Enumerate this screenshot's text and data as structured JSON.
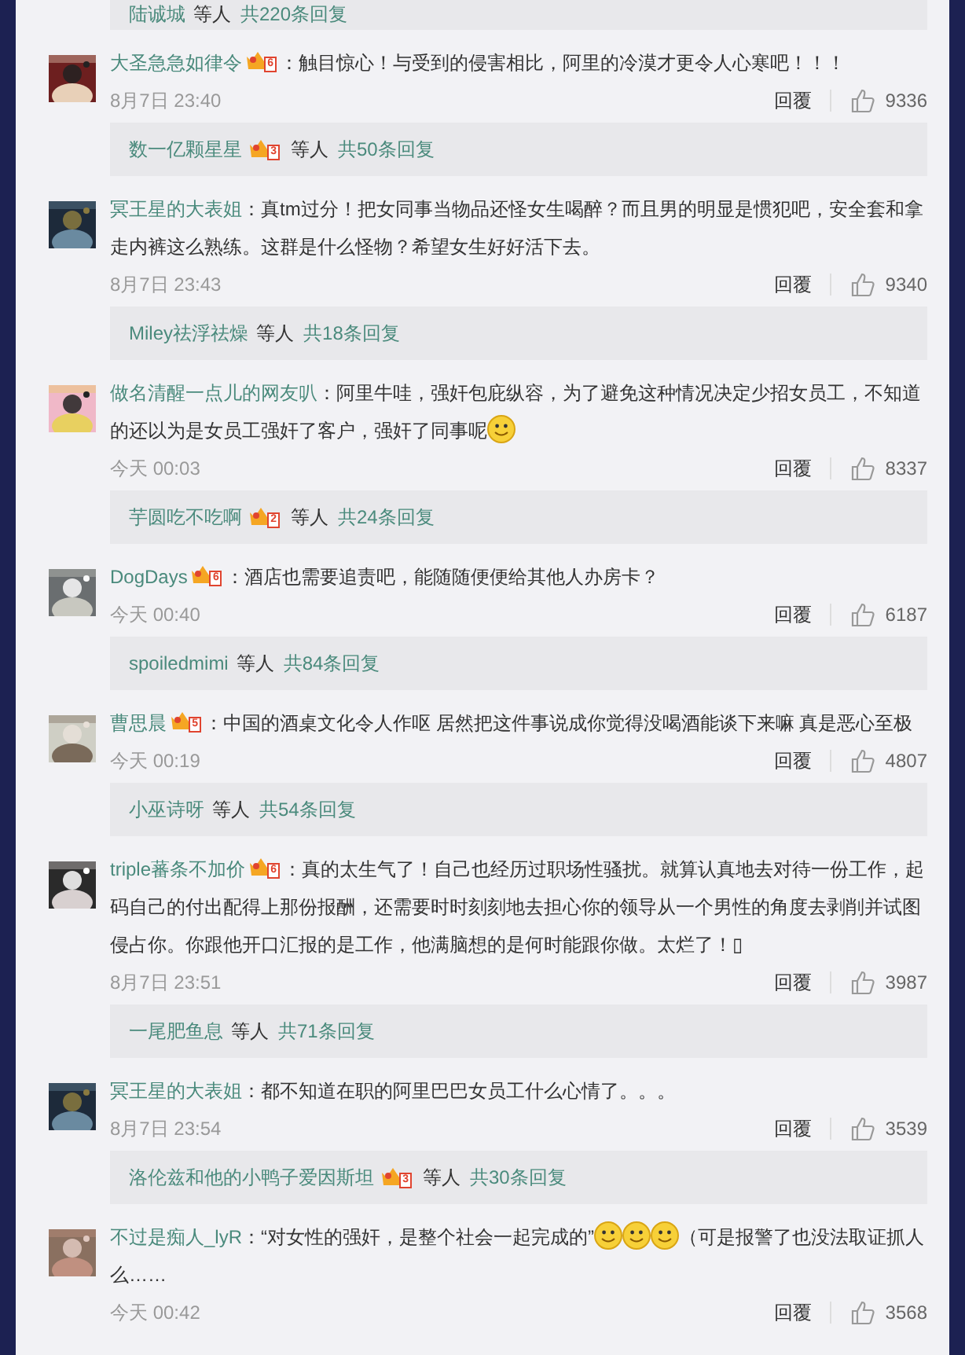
{
  "items": [
    {
      "kind": "reply_bar",
      "name": "陆诚城",
      "others": "等人",
      "count": "共220条回复"
    },
    {
      "kind": "comment",
      "name": "大圣急急如律令",
      "badge": "6",
      "parts": [
        {
          "kind": "text",
          "text": "：触目惊心！与受到的侵害相比，阿里的冷漠才更令人心寒吧！！！"
        }
      ],
      "time": "8月7日 23:40",
      "reply": "回覆",
      "likes": "9336"
    },
    {
      "kind": "reply_bar",
      "name": "数一亿颗星星",
      "badge": "3",
      "others": "等人",
      "count": "共50条回复"
    },
    {
      "kind": "comment",
      "name": "冥王星的大表姐",
      "parts": [
        {
          "kind": "text",
          "text": "：真tm过分！把女同事当物品还怪女生喝醉？而且男的明显是惯犯吧，安全套和拿走内裤这么熟练。这群是什么怪物？希望女生好好活下去。"
        }
      ],
      "time": "8月7日 23:43",
      "reply": "回覆",
      "likes": "9340"
    },
    {
      "kind": "reply_bar",
      "name": "Miley祛浮祛燥",
      "others": "等人",
      "count": "共18条回复"
    },
    {
      "kind": "comment",
      "name": "做名清醒一点儿的网友叭",
      "parts": [
        {
          "kind": "text",
          "text": "：阿里牛哇，强奸包庇纵容，为了避免这种情况决定少招女员工，不知道的还以为是女员工强奸了客户，强奸了同事呢"
        },
        {
          "kind": "smiley"
        }
      ],
      "time": "今天 00:03",
      "reply": "回覆",
      "likes": "8337"
    },
    {
      "kind": "reply_bar",
      "name": "芋圆吃不吃啊",
      "badge": "2",
      "others": "等人",
      "count": "共24条回复"
    },
    {
      "kind": "comment",
      "name": "DogDays",
      "badge": "6",
      "parts": [
        {
          "kind": "text",
          "text": "：酒店也需要追责吧，能随随便便给其他人办房卡？"
        }
      ],
      "time": "今天 00:40",
      "reply": "回覆",
      "likes": "6187"
    },
    {
      "kind": "reply_bar",
      "name": "spoiledmimi",
      "others": "等人",
      "count": "共84条回复"
    },
    {
      "kind": "comment",
      "name": "曹思晨",
      "badge": "5",
      "parts": [
        {
          "kind": "text",
          "text": "：中国的酒桌文化令人作呕 居然把这件事说成你觉得没喝酒能谈下来嘛 真是恶心至极"
        }
      ],
      "time": "今天 00:19",
      "reply": "回覆",
      "likes": "4807"
    },
    {
      "kind": "reply_bar",
      "name": "小巫诗呀",
      "others": "等人",
      "count": "共54条回复"
    },
    {
      "kind": "comment",
      "name": "triple蕃条不加价",
      "badge": "6",
      "parts": [
        {
          "kind": "text",
          "text": "：真的太生气了！自己也经历过职场性骚扰。就算认真地去对待一份工作，起码自己的付出配得上那份报酬，还需要时时刻刻地去担心你的领导从一个男性的角度去剥削并试图侵占你。你跟他开口汇报的是工作，他满脑想的是何时能跟你做。太烂了！▯"
        }
      ],
      "time": "8月7日 23:51",
      "reply": "回覆",
      "likes": "3987"
    },
    {
      "kind": "reply_bar",
      "name": "一尾肥鱼息",
      "others": "等人",
      "count": "共71条回复"
    },
    {
      "kind": "comment",
      "name": "冥王星的大表姐",
      "parts": [
        {
          "kind": "text",
          "text": "：都不知道在职的阿里巴巴女员工什么心情了。。。"
        }
      ],
      "time": "8月7日 23:54",
      "reply": "回覆",
      "likes": "3539"
    },
    {
      "kind": "reply_bar",
      "name": "洛伦兹和他的小鸭子爱因斯坦",
      "badge": "3",
      "others": "等人",
      "count": "共30条回复"
    },
    {
      "kind": "comment",
      "name": "不过是痴人_lyR",
      "parts": [
        {
          "kind": "text",
          "text": "：“对女性的强奸，是整个社会一起完成的”"
        },
        {
          "kind": "smiley"
        },
        {
          "kind": "smiley"
        },
        {
          "kind": "smiley"
        },
        {
          "kind": "text",
          "text": "（可是报警了也没法取证抓人么……"
        }
      ],
      "time": "今天 00:42",
      "reply": "回覆",
      "likes": "3568"
    }
  ]
}
